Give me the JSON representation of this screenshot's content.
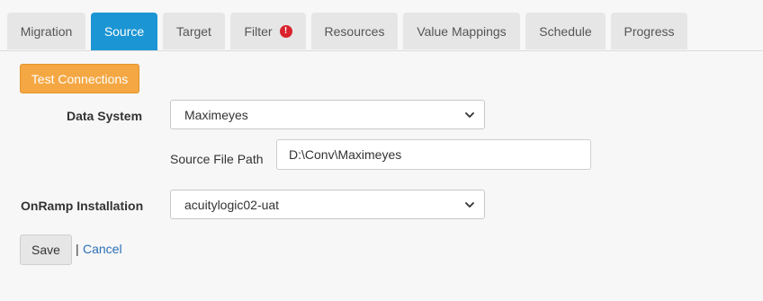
{
  "tabs": [
    {
      "label": "Migration",
      "active": false
    },
    {
      "label": "Source",
      "active": true
    },
    {
      "label": "Target",
      "active": false
    },
    {
      "label": "Filter",
      "active": false,
      "warning": "!"
    },
    {
      "label": "Resources",
      "active": false
    },
    {
      "label": "Value Mappings",
      "active": false
    },
    {
      "label": "Schedule",
      "active": false
    },
    {
      "label": "Progress",
      "active": false
    }
  ],
  "actions": {
    "test_connections": "Test Connections"
  },
  "form": {
    "data_system": {
      "label": "Data System",
      "value": "Maximeyes"
    },
    "source_file_path": {
      "label": "Source File Path",
      "value": "D:\\Conv\\Maximeyes"
    },
    "onramp_installation": {
      "label": "OnRamp Installation",
      "value": "acuitylogic02-uat"
    }
  },
  "footer": {
    "save": "Save",
    "separator": "|",
    "cancel": "Cancel"
  },
  "colors": {
    "accent": "#1b95d3",
    "warning_button": "#f4a742",
    "alert": "#d9232d",
    "link": "#2a6fb6"
  }
}
